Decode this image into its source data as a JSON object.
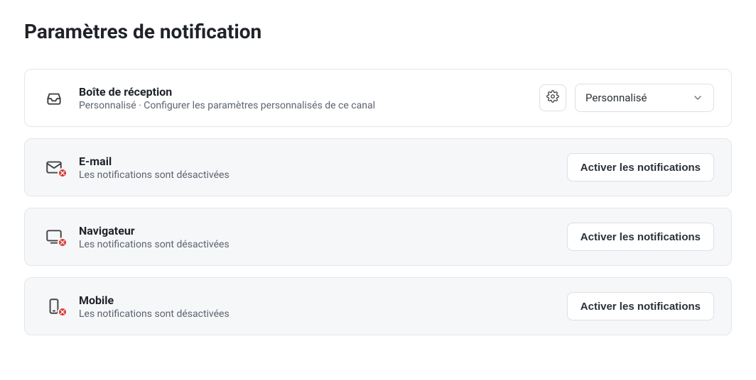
{
  "title": "Paramètres de notification",
  "channels": {
    "inbox": {
      "title": "Boîte de réception",
      "sub": "Personnalisé · Configurer les paramètres personnalisés de ce canal",
      "select_value": "Personnalisé"
    },
    "email": {
      "title": "E-mail",
      "sub": "Les notifications sont désactivées",
      "button": "Activer les notifications"
    },
    "browser": {
      "title": "Navigateur",
      "sub": "Les notifications sont désactivées",
      "button": "Activer les notifications"
    },
    "mobile": {
      "title": "Mobile",
      "sub": "Les notifications sont désactivées",
      "button": "Activer les notifications"
    }
  }
}
